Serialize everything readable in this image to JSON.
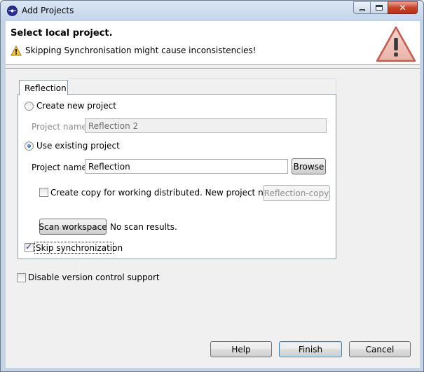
{
  "window": {
    "title": "Add Projects",
    "controls": {
      "minimize": "minimize",
      "maximize": "maximize",
      "close": "✕"
    }
  },
  "banner": {
    "title": "Select local project.",
    "message": "Skipping Synchronisation might cause inconsistencies!",
    "icons": {
      "small": "warning-icon",
      "large": "warning-large-icon"
    }
  },
  "tab": {
    "label": "Reflection"
  },
  "options": {
    "create_new": {
      "label": "Create new project",
      "checked": false
    },
    "new_project_name_label": "Project name",
    "new_project_name_value": "Reflection 2",
    "use_existing": {
      "label": "Use existing project",
      "checked": true
    },
    "existing_project_name_label": "Project name",
    "existing_project_name_value": "Reflection",
    "browse_label": "Browse",
    "create_copy": {
      "label": "Create copy for working distributed. New project name:",
      "checked": false
    },
    "copy_name_button": "Reflection-copy",
    "scan_button": "Scan workspace",
    "scan_result": "No scan results.",
    "skip_sync": {
      "label": "Skip synchronization",
      "checked": true
    }
  },
  "disable_vcs": {
    "label": "Disable version control support",
    "checked": false
  },
  "footer": {
    "help": "Help",
    "finish": "Finish",
    "cancel": "Cancel"
  },
  "colors": {
    "title_bar": "#c2d4ea",
    "close_button": "#c8442a",
    "warning": "#f2c84b",
    "large_warning": "#c25b4f"
  }
}
